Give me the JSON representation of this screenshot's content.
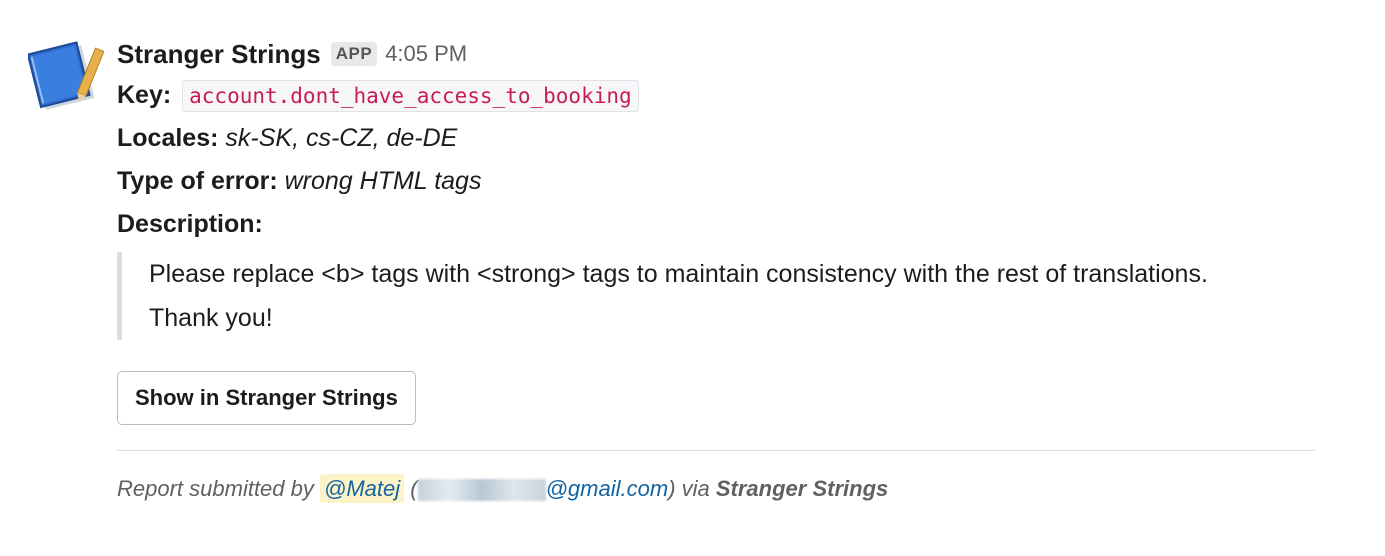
{
  "message": {
    "sender": "Stranger Strings",
    "badge": "APP",
    "time": "4:05 PM",
    "key_label": "Key:",
    "key_value": "account.dont_have_access_to_booking",
    "locales_label": "Locales:",
    "locales_value": "sk-SK, cs-CZ, de-DE",
    "error_label": "Type of error:",
    "error_value": "wrong HTML tags",
    "description_label": "Description:",
    "description_text": "Please replace <b> tags with <strong> tags to maintain consistency with the rest of translations. Thank you!",
    "button_label": "Show in Stranger Strings"
  },
  "footer": {
    "prefix": "Report submitted by",
    "mention": "@Matej",
    "open_paren": "(",
    "email_domain": "@gmail.com",
    "close_via": ") via",
    "via_name": "Stranger Strings"
  },
  "colors": {
    "code_text": "#c71d55",
    "link": "#1264a3",
    "mention_bg": "#fdf3c8"
  }
}
